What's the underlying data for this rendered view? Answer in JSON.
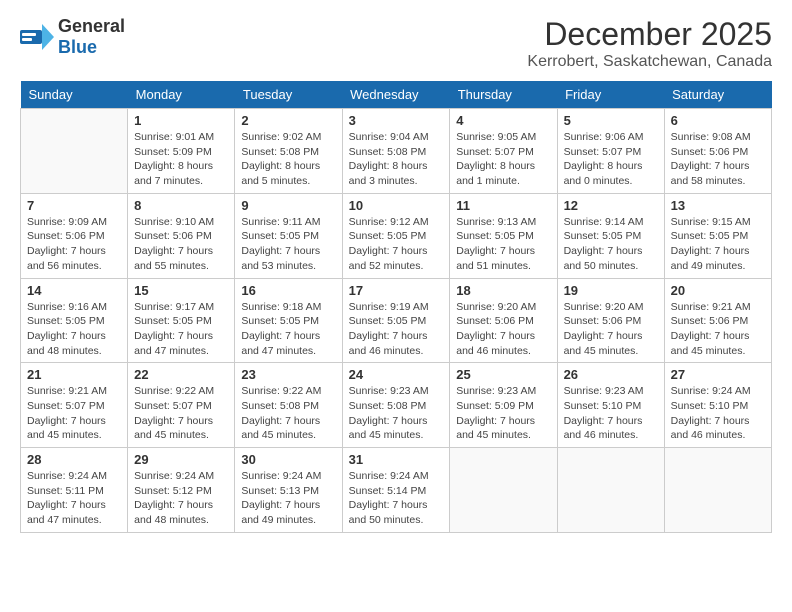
{
  "header": {
    "logo_general": "General",
    "logo_blue": "Blue",
    "month": "December 2025",
    "location": "Kerrobert, Saskatchewan, Canada"
  },
  "weekdays": [
    "Sunday",
    "Monday",
    "Tuesday",
    "Wednesday",
    "Thursday",
    "Friday",
    "Saturday"
  ],
  "weeks": [
    [
      {
        "day": "",
        "sunrise": "",
        "sunset": "",
        "daylight": ""
      },
      {
        "day": "1",
        "sunrise": "Sunrise: 9:01 AM",
        "sunset": "Sunset: 5:09 PM",
        "daylight": "Daylight: 8 hours and 7 minutes."
      },
      {
        "day": "2",
        "sunrise": "Sunrise: 9:02 AM",
        "sunset": "Sunset: 5:08 PM",
        "daylight": "Daylight: 8 hours and 5 minutes."
      },
      {
        "day": "3",
        "sunrise": "Sunrise: 9:04 AM",
        "sunset": "Sunset: 5:08 PM",
        "daylight": "Daylight: 8 hours and 3 minutes."
      },
      {
        "day": "4",
        "sunrise": "Sunrise: 9:05 AM",
        "sunset": "Sunset: 5:07 PM",
        "daylight": "Daylight: 8 hours and 1 minute."
      },
      {
        "day": "5",
        "sunrise": "Sunrise: 9:06 AM",
        "sunset": "Sunset: 5:07 PM",
        "daylight": "Daylight: 8 hours and 0 minutes."
      },
      {
        "day": "6",
        "sunrise": "Sunrise: 9:08 AM",
        "sunset": "Sunset: 5:06 PM",
        "daylight": "Daylight: 7 hours and 58 minutes."
      }
    ],
    [
      {
        "day": "7",
        "sunrise": "Sunrise: 9:09 AM",
        "sunset": "Sunset: 5:06 PM",
        "daylight": "Daylight: 7 hours and 56 minutes."
      },
      {
        "day": "8",
        "sunrise": "Sunrise: 9:10 AM",
        "sunset": "Sunset: 5:06 PM",
        "daylight": "Daylight: 7 hours and 55 minutes."
      },
      {
        "day": "9",
        "sunrise": "Sunrise: 9:11 AM",
        "sunset": "Sunset: 5:05 PM",
        "daylight": "Daylight: 7 hours and 53 minutes."
      },
      {
        "day": "10",
        "sunrise": "Sunrise: 9:12 AM",
        "sunset": "Sunset: 5:05 PM",
        "daylight": "Daylight: 7 hours and 52 minutes."
      },
      {
        "day": "11",
        "sunrise": "Sunrise: 9:13 AM",
        "sunset": "Sunset: 5:05 PM",
        "daylight": "Daylight: 7 hours and 51 minutes."
      },
      {
        "day": "12",
        "sunrise": "Sunrise: 9:14 AM",
        "sunset": "Sunset: 5:05 PM",
        "daylight": "Daylight: 7 hours and 50 minutes."
      },
      {
        "day": "13",
        "sunrise": "Sunrise: 9:15 AM",
        "sunset": "Sunset: 5:05 PM",
        "daylight": "Daylight: 7 hours and 49 minutes."
      }
    ],
    [
      {
        "day": "14",
        "sunrise": "Sunrise: 9:16 AM",
        "sunset": "Sunset: 5:05 PM",
        "daylight": "Daylight: 7 hours and 48 minutes."
      },
      {
        "day": "15",
        "sunrise": "Sunrise: 9:17 AM",
        "sunset": "Sunset: 5:05 PM",
        "daylight": "Daylight: 7 hours and 47 minutes."
      },
      {
        "day": "16",
        "sunrise": "Sunrise: 9:18 AM",
        "sunset": "Sunset: 5:05 PM",
        "daylight": "Daylight: 7 hours and 47 minutes."
      },
      {
        "day": "17",
        "sunrise": "Sunrise: 9:19 AM",
        "sunset": "Sunset: 5:05 PM",
        "daylight": "Daylight: 7 hours and 46 minutes."
      },
      {
        "day": "18",
        "sunrise": "Sunrise: 9:20 AM",
        "sunset": "Sunset: 5:06 PM",
        "daylight": "Daylight: 7 hours and 46 minutes."
      },
      {
        "day": "19",
        "sunrise": "Sunrise: 9:20 AM",
        "sunset": "Sunset: 5:06 PM",
        "daylight": "Daylight: 7 hours and 45 minutes."
      },
      {
        "day": "20",
        "sunrise": "Sunrise: 9:21 AM",
        "sunset": "Sunset: 5:06 PM",
        "daylight": "Daylight: 7 hours and 45 minutes."
      }
    ],
    [
      {
        "day": "21",
        "sunrise": "Sunrise: 9:21 AM",
        "sunset": "Sunset: 5:07 PM",
        "daylight": "Daylight: 7 hours and 45 minutes."
      },
      {
        "day": "22",
        "sunrise": "Sunrise: 9:22 AM",
        "sunset": "Sunset: 5:07 PM",
        "daylight": "Daylight: 7 hours and 45 minutes."
      },
      {
        "day": "23",
        "sunrise": "Sunrise: 9:22 AM",
        "sunset": "Sunset: 5:08 PM",
        "daylight": "Daylight: 7 hours and 45 minutes."
      },
      {
        "day": "24",
        "sunrise": "Sunrise: 9:23 AM",
        "sunset": "Sunset: 5:08 PM",
        "daylight": "Daylight: 7 hours and 45 minutes."
      },
      {
        "day": "25",
        "sunrise": "Sunrise: 9:23 AM",
        "sunset": "Sunset: 5:09 PM",
        "daylight": "Daylight: 7 hours and 45 minutes."
      },
      {
        "day": "26",
        "sunrise": "Sunrise: 9:23 AM",
        "sunset": "Sunset: 5:10 PM",
        "daylight": "Daylight: 7 hours and 46 minutes."
      },
      {
        "day": "27",
        "sunrise": "Sunrise: 9:24 AM",
        "sunset": "Sunset: 5:10 PM",
        "daylight": "Daylight: 7 hours and 46 minutes."
      }
    ],
    [
      {
        "day": "28",
        "sunrise": "Sunrise: 9:24 AM",
        "sunset": "Sunset: 5:11 PM",
        "daylight": "Daylight: 7 hours and 47 minutes."
      },
      {
        "day": "29",
        "sunrise": "Sunrise: 9:24 AM",
        "sunset": "Sunset: 5:12 PM",
        "daylight": "Daylight: 7 hours and 48 minutes."
      },
      {
        "day": "30",
        "sunrise": "Sunrise: 9:24 AM",
        "sunset": "Sunset: 5:13 PM",
        "daylight": "Daylight: 7 hours and 49 minutes."
      },
      {
        "day": "31",
        "sunrise": "Sunrise: 9:24 AM",
        "sunset": "Sunset: 5:14 PM",
        "daylight": "Daylight: 7 hours and 50 minutes."
      },
      {
        "day": "",
        "sunrise": "",
        "sunset": "",
        "daylight": ""
      },
      {
        "day": "",
        "sunrise": "",
        "sunset": "",
        "daylight": ""
      },
      {
        "day": "",
        "sunrise": "",
        "sunset": "",
        "daylight": ""
      }
    ]
  ]
}
